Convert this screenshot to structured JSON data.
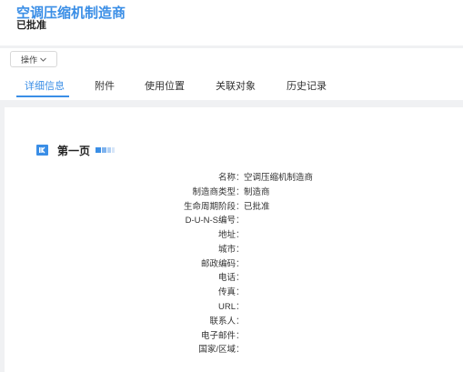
{
  "header": {
    "title": "空调压缩机制造商",
    "status": "已批准"
  },
  "toolbar": {
    "action_label": "操作"
  },
  "tabs": [
    {
      "label": "详细信息",
      "active": true
    },
    {
      "label": "附件",
      "active": false
    },
    {
      "label": "使用位置",
      "active": false
    },
    {
      "label": "关联对象",
      "active": false
    },
    {
      "label": "历史记录",
      "active": false
    }
  ],
  "section": {
    "title": "第一页"
  },
  "colon": "：",
  "fields": [
    {
      "label": "名称",
      "value": "空调压缩机制造商"
    },
    {
      "label": "制造商类型",
      "value": "制造商"
    },
    {
      "label": "生命周期阶段",
      "value": "已批准"
    },
    {
      "label": "D-U-N-S编号",
      "value": ""
    },
    {
      "label": "地址",
      "value": ""
    },
    {
      "label": "城市",
      "value": ""
    },
    {
      "label": "邮政编码",
      "value": ""
    },
    {
      "label": "电话",
      "value": ""
    },
    {
      "label": "传真",
      "value": ""
    },
    {
      "label": "URL",
      "value": ""
    },
    {
      "label": "联系人",
      "value": ""
    },
    {
      "label": "电子邮件",
      "value": ""
    },
    {
      "label": "国家/区域",
      "value": ""
    }
  ],
  "colors": {
    "accent": "#3a8ee6",
    "background": "#f0f1f3"
  },
  "icons": {
    "action_caret": "chevron-down-icon",
    "section": "section-icon"
  }
}
